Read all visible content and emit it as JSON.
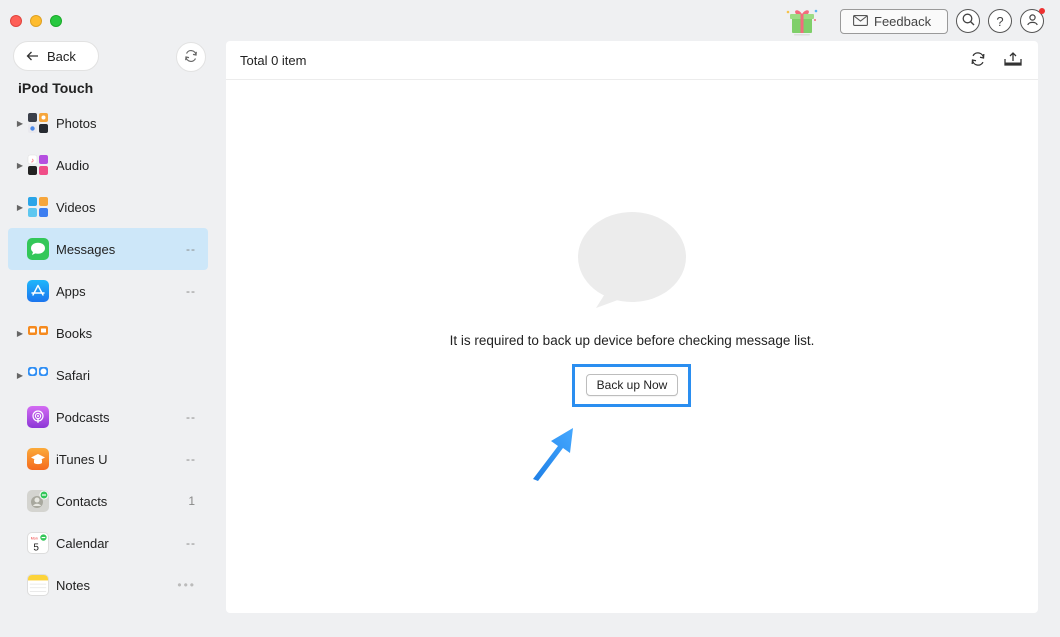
{
  "titlebar": {
    "feedback_label": "Feedback"
  },
  "sidebar": {
    "back_label": "Back",
    "device_name": "iPod Touch",
    "items": [
      {
        "label": "Photos",
        "count": "",
        "expandable": true,
        "icon": "photos-icon"
      },
      {
        "label": "Audio",
        "count": "",
        "expandable": true,
        "icon": "audio-icon"
      },
      {
        "label": "Videos",
        "count": "",
        "expandable": true,
        "icon": "videos-icon"
      },
      {
        "label": "Messages",
        "count": "--",
        "expandable": false,
        "icon": "messages-icon",
        "active": true
      },
      {
        "label": "Apps",
        "count": "--",
        "expandable": false,
        "icon": "apps-icon"
      },
      {
        "label": "Books",
        "count": "",
        "expandable": true,
        "icon": "books-icon"
      },
      {
        "label": "Safari",
        "count": "",
        "expandable": true,
        "icon": "safari-icon"
      },
      {
        "label": "Podcasts",
        "count": "--",
        "expandable": false,
        "icon": "podcasts-icon"
      },
      {
        "label": "iTunes U",
        "count": "--",
        "expandable": false,
        "icon": "itunes-u-icon"
      },
      {
        "label": "Contacts",
        "count": "1",
        "expandable": false,
        "icon": "contacts-icon"
      },
      {
        "label": "Calendar",
        "count": "--",
        "expandable": false,
        "icon": "calendar-icon"
      },
      {
        "label": "Notes",
        "count": "•••",
        "expandable": false,
        "icon": "notes-icon"
      }
    ]
  },
  "main": {
    "total_label": "Total 0 item",
    "message": "It is required to back up device before checking message list.",
    "backup_button": "Back up Now"
  },
  "colors": {
    "accent": "#2a8ef0",
    "active_row": "#cde7f9"
  }
}
